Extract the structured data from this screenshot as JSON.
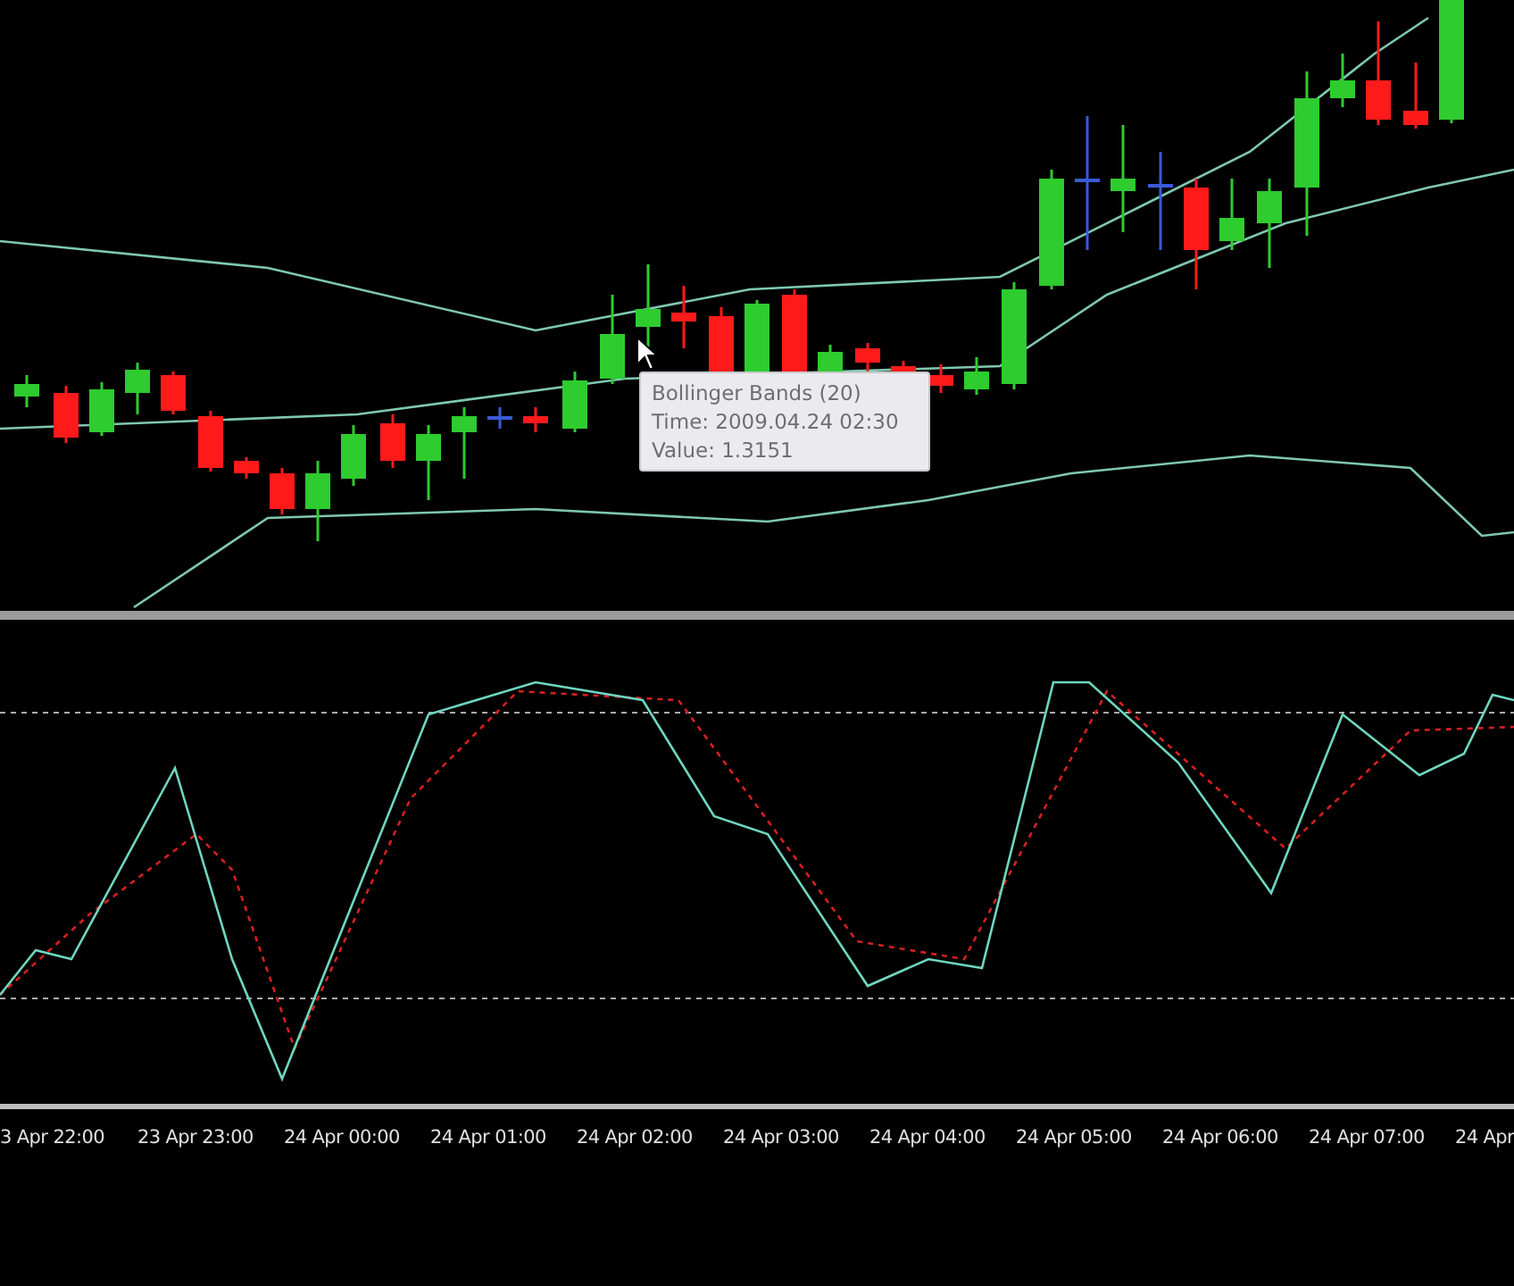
{
  "price_chart": {
    "tooltip": {
      "title": "Bollinger Bands (20)",
      "lines": [
        "Time: 2009.04.24 02:30",
        "Value: 1.3151"
      ]
    }
  },
  "time_axis": {
    "labels": [
      "3 Apr 22:00",
      "23 Apr 23:00",
      "24 Apr 00:00",
      "24 Apr 01:00",
      "24 Apr 02:00",
      "24 Apr 03:00",
      "24 Apr 04:00",
      "24 Apr 05:00",
      "24 Apr 06:00",
      "24 Apr 07:00",
      "24 Apr"
    ]
  }
}
